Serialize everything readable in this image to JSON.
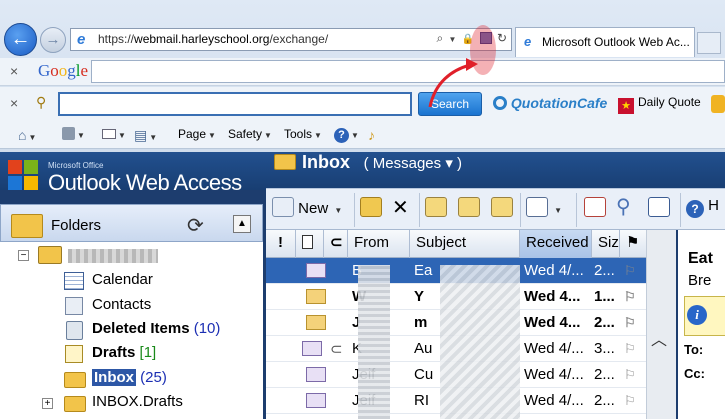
{
  "browser": {
    "url_prefix": "https://",
    "url_host": "webmail.harleyschool.org",
    "url_path": "/exchange/",
    "tab_title": "Microsoft Outlook Web Ac...",
    "back_glyph": "←",
    "fwd_glyph": "→",
    "search_glyph": "⌕",
    "lock_glyph": "🔒",
    "refresh_glyph": "↻"
  },
  "google_toolbar": {
    "close_glyph": "×",
    "logo": "Google"
  },
  "search_toolbar": {
    "close_glyph": "×",
    "key_glyph": "⚲",
    "search_button": "Search",
    "quotation_cafe": "QuotationCafe",
    "daily_quote": "Daily Quote"
  },
  "command_bar": {
    "page": "Page",
    "safety": "Safety",
    "tools": "Tools",
    "help_glyph": "?"
  },
  "owa": {
    "brand_small": "Microsoft Office",
    "brand": "Outlook Web Access",
    "inbox_title": "Inbox",
    "view_label": "( Messages ▾ )",
    "folders_label": "Folders",
    "folders": [
      {
        "label": "Calendar",
        "count": ""
      },
      {
        "label": "Contacts",
        "count": ""
      },
      {
        "label": "Deleted Items",
        "count": "(10)"
      },
      {
        "label": "Drafts",
        "count": "[1]"
      },
      {
        "label": "Inbox",
        "count": "(25)"
      },
      {
        "label": "INBOX.Drafts",
        "count": ""
      }
    ],
    "toolbar": {
      "new_label": "New",
      "help_fragment": "H"
    },
    "columns": {
      "importance": "!",
      "type": "",
      "attachment": "",
      "from": "From",
      "subject": "Subject",
      "received": "Received",
      "size": "Size"
    },
    "messages": [
      {
        "from": "B",
        "subject": "Ea",
        "received": "Wed 4/...",
        "size": "2...",
        "selected": true,
        "unread": false
      },
      {
        "from": "W",
        "subject": "Y",
        "received": "Wed 4...",
        "size": "1...",
        "selected": false,
        "unread": true
      },
      {
        "from": "J",
        "subject": "m",
        "received": "Wed 4...",
        "size": "2...",
        "selected": false,
        "unread": true
      },
      {
        "from": "K",
        "subject": "Au",
        "received": "Wed 4/...",
        "size": "3...",
        "selected": false,
        "unread": false
      },
      {
        "from": "Jeif",
        "subject": "Cu",
        "received": "Wed 4/...",
        "size": "2...",
        "selected": false,
        "unread": false
      },
      {
        "from": "Jeif",
        "subject": "RI",
        "received": "Wed 4/...",
        "size": "2...",
        "selected": false,
        "unread": false
      }
    ],
    "reading": {
      "title": "Eat",
      "subtitle": "Bre",
      "info_glyph": "i",
      "to_label": "To:",
      "cc_label": "Cc:"
    }
  },
  "colors": {
    "owa_header": "#1d3d6e",
    "selection": "#2d65b5",
    "unread_count": "#1c2fb3",
    "annotation_arrow": "#e0202a"
  }
}
